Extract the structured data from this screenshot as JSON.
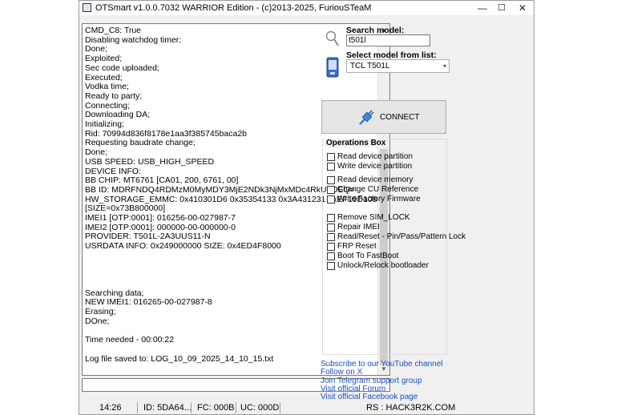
{
  "window": {
    "title": "OTSmart  v1.0.0.7032 WARRIOR Edition - (c)2013-2025, FuriouSTeaM",
    "minimize": "—",
    "maximize": "☐",
    "close": "✕"
  },
  "log": {
    "text": "CMD_C8: True\nDisabling watchdog timer;\nDone;\nExploited;\nSec code uploaded;\nExecuted;\nVodka time;\nReady to party;\nConnecting;\nDownloading DA;\nInitializing;\nRid: 70994d836f8178e1aa3f385745baca2b\nRequesting baudrate change;\nDone;\nUSB SPEED: USB_HIGH_SPEED\nDEVICE INFO:\nBB CHIP: MT6761 [CA01, 200, 6761, 00]\nBB ID: MDRFNDQ4RDMzM0MyMDY3MjE2NDk3NjMxMDc4RkU3OEQ=\nHW_STORAGE_EMMC: 0x410301D6 0x35354133 0x3A431231 0xEF19D108\n[SIZE=0x73B800000]\nIMEI1 [OTP:0001]: 016256-00-027987-7\nIMEI2 [OTP:0001]: 000000-00-000000-0\nPROVIDER: T501L-2A3UUS11-N\nUSRDATA INFO: 0x249000000 SIZE: 0x4ED4F8000\n\n\n\n\nSearching data;\nNEW IMEI1: 016265-00-027987-8\nErasing;\nDOne;\n\nTime needed - 00:00:22\n\nLog file saved to: LOG_10_09_2025_14_10_15.txt"
  },
  "search": {
    "label": "Search model:",
    "value": "t501l"
  },
  "model_select": {
    "label": "Select model from list:",
    "value": "TCL T501L"
  },
  "connect_button": {
    "label": "CONNECT"
  },
  "operations": {
    "title": "Operations Box",
    "items": [
      "Read device partition",
      "Write device partition",
      "Read device memory",
      "Change CU Reference",
      "Write Factory Firmware",
      "Remove SIM_LOCK",
      "Repair IMEI",
      "Read/Reset - Pin/Pass/Pattern Lock",
      "FRP Reset",
      "Boot To FastBoot",
      "Unlock/Relock bootloader"
    ]
  },
  "links": [
    "Subscribe to our YouTube channel",
    "Follow on X",
    "Join Telegram support group",
    "Visit official Forum",
    "Visit official Facebook page"
  ],
  "status": {
    "time": "14:26",
    "id": "ID: 5DA64...",
    "fc": "FC: 000B",
    "uc": "UC: 000D",
    "rs": "RS : HACK3R2K.COM"
  },
  "colors": {
    "link": "#1a4fc4",
    "window_bg": "#f0f0f0"
  }
}
